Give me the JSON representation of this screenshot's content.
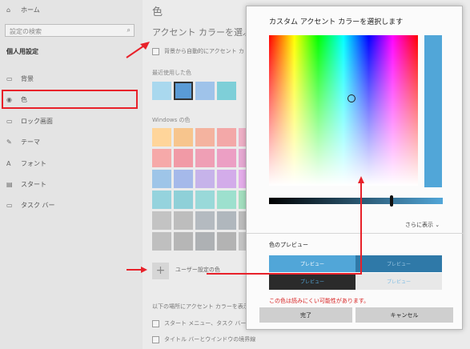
{
  "sidebar": {
    "home": "ホーム",
    "search_placeholder": "設定の検索",
    "section": "個人用設定",
    "items": [
      "背景",
      "色",
      "ロック画面",
      "テーマ",
      "フォント",
      "スタート",
      "タスク バー"
    ]
  },
  "main": {
    "title": "色",
    "subtitle": "アクセント カラーを選ぶ",
    "auto_check": "背景から自動的にアクセント カ",
    "recent_label": "最近使用した色",
    "windows_label": "Windows の色",
    "custom_label": "ユーザー設定の色",
    "apply_label": "以下の場所にアクセント カラーを表示",
    "cb_start": "スタート メニュー、タスク バー、アク",
    "cb_title": "タイトル バーとウインドウの境界線"
  },
  "dialog": {
    "title": "カスタム アクセント カラーを選択します",
    "more": "さらに表示",
    "preview_title": "色のプレビュー",
    "preview_cells": [
      "プレビュー",
      "プレビュー",
      "プレビュー",
      "プレビュー"
    ],
    "warning": "この色は読みにくい可能性があります。",
    "done": "完了",
    "cancel": "キャンセル"
  },
  "colors": {
    "accent": "#51a6d8",
    "warning": "#d71f1f",
    "red_annotation": "#e8212a"
  }
}
